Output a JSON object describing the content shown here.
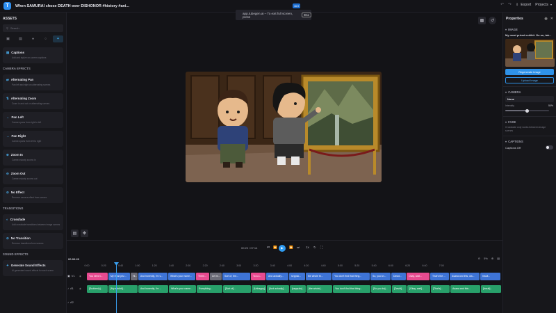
{
  "topbar": {
    "title": "When SAMURAI chose DEATH over DISHONOR #history #ani...",
    "zoom_badge": "16:9",
    "export_label": "Export",
    "projects_label": "Projects"
  },
  "fullscreen_toast": {
    "text": "app.tubegen.ai – To exit full screen, press",
    "key": "Esc"
  },
  "assets": {
    "heading": "ASSETS",
    "search_placeholder": "Search",
    "captions": {
      "title": "Captions",
      "desc": "Add and stylize on-screen captions"
    },
    "camera_heading": "CAMERA EFFECTS",
    "camera_effects": [
      {
        "title": "Alternating Pan",
        "desc": "Pan left and right on alternating scenes"
      },
      {
        "title": "Alternating Zoom",
        "desc": "Zoom in and out on alternating scenes"
      },
      {
        "title": "Pan Left",
        "desc": "Camera pans from right to left"
      },
      {
        "title": "Pan Right",
        "desc": "Camera pans from left to right"
      },
      {
        "title": "Zoom In",
        "desc": "Camera slowly zooms in"
      },
      {
        "title": "Zoom Out",
        "desc": "Camera slowly zooms out"
      },
      {
        "title": "No Effect",
        "desc": "Remove camera effect from scenes"
      }
    ],
    "transitions_heading": "TRANSITIONS",
    "transitions": [
      {
        "title": "Crossfade",
        "desc": "Add crossfade transitions between image scenes (~0.5s)"
      },
      {
        "title": "No Transition",
        "desc": "Remove transitions from scenes"
      }
    ],
    "sound_heading": "SOUND EFFECTS",
    "sound": [
      {
        "title": "Generate Sound Effects",
        "desc": "AI-generated sound effects for each scene"
      }
    ]
  },
  "properties": {
    "heading": "Properties",
    "image_section": "IMAGE",
    "image_title": "My most prized exhibit. Go on, tak...",
    "regenerate_label": "Regenerate Image",
    "upload_label": "Upload Image",
    "camera_section": "CAMERA",
    "camera_value": "None",
    "intensity_label": "Intensity",
    "intensity_value": "50%",
    "intensity_fraction": 0.5,
    "fade_section": "FADE",
    "fade_desc": "Crossfade only works between image scenes",
    "captions_section": "CAPTIONS",
    "captions_toggle_label": "Captions Off"
  },
  "timeline": {
    "current_time": "00:00:20",
    "time_display": "00:20 / 07:14",
    "speed": "1x",
    "zoom_percent": "5%",
    "ruler_ticks": [
      "0:00",
      "0:20",
      "0:40",
      "1:00",
      "1:20",
      "1:40",
      "2:00",
      "2:20",
      "2:40",
      "3:00",
      "3:20",
      "3:40",
      "4:00",
      "4:20",
      "4:40",
      "5:00",
      "5:20",
      "5:40",
      "6:00",
      "6:20",
      "6:40",
      "7:00"
    ],
    "tracks": [
      {
        "label": "V1"
      },
      {
        "label": "A1"
      },
      {
        "label": "A2"
      }
    ],
    "video_clips": [
      {
        "text": "You need t...",
        "color": "pink"
      },
      {
        "text": "My most priz...",
        "color": "blue"
      },
      {
        "text": "Hi...",
        "color": "gray"
      },
      {
        "text": "And honestly, I'm s...",
        "color": "blue"
      },
      {
        "text": "What's your name...",
        "color": "blue"
      },
      {
        "text": "There...",
        "color": "pink"
      },
      {
        "text": "Let m...",
        "color": "gray"
      },
      {
        "text": "Sort of, the...",
        "color": "blue"
      },
      {
        "text": "To a c...",
        "color": "pink"
      },
      {
        "text": "And actually...",
        "color": "blue"
      },
      {
        "text": "seppuk...",
        "color": "blue"
      },
      {
        "text": "the whole th...",
        "color": "blue"
      },
      {
        "text": "You don't find that thing...",
        "color": "blue"
      },
      {
        "text": "So, you kn...",
        "color": "blue"
      },
      {
        "text": "David...",
        "color": "blue"
      },
      {
        "text": "Okay, wait...",
        "color": "pink"
      },
      {
        "text": "That's the ...",
        "color": "blue"
      },
      {
        "text": "Asana and this, wa...",
        "color": "blue"
      },
      {
        "text": "Insult...",
        "color": "blue"
      }
    ],
    "audio_clips": [
      {
        "text": "[Suddenly]...",
        "color": "green"
      },
      {
        "text": "[My exhibit]...",
        "color": "green"
      },
      {
        "text": "And honestly, I'm ...",
        "color": "green"
      },
      {
        "text": "What's your name...",
        "color": "green"
      },
      {
        "text": "Everything...",
        "color": "green"
      },
      {
        "text": "[Sort of]...",
        "color": "green"
      },
      {
        "text": "[Unhappy]...",
        "color": "green"
      },
      {
        "text": "[And actually]...",
        "color": "green"
      },
      {
        "text": "[seppuku]...",
        "color": "green"
      },
      {
        "text": "[the whole]...",
        "color": "green"
      },
      {
        "text": "You don't find that thing...",
        "color": "green"
      },
      {
        "text": "[So you kn]...",
        "color": "green"
      },
      {
        "text": "[David]...",
        "color": "green"
      },
      {
        "text": "[Okay, wait]...",
        "color": "green"
      },
      {
        "text": "[That's]...",
        "color": "green"
      },
      {
        "text": "Asana and this...",
        "color": "green"
      },
      {
        "text": "[Insult]...",
        "color": "green"
      }
    ]
  },
  "colors": {
    "accent": "#2f92e8",
    "pink_clip": "#e84b90",
    "blue_clip": "#3e74d6",
    "green_clip": "#28a06a"
  }
}
